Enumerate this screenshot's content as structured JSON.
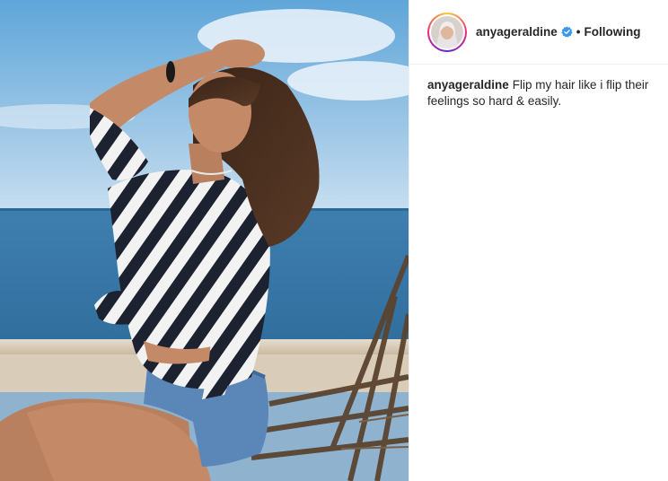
{
  "post": {
    "author": {
      "username": "anyageraldine",
      "verified": true,
      "follow_state": "Following",
      "separator": "•"
    },
    "caption": {
      "username": "anyageraldine",
      "text": "Flip my hair like i flip their feelings so hard & easily."
    },
    "icons": {
      "verified": "verified-badge-icon"
    },
    "colors": {
      "verified_badge": "#3897f0",
      "text": "#262626",
      "divider": "#efefef"
    }
  }
}
